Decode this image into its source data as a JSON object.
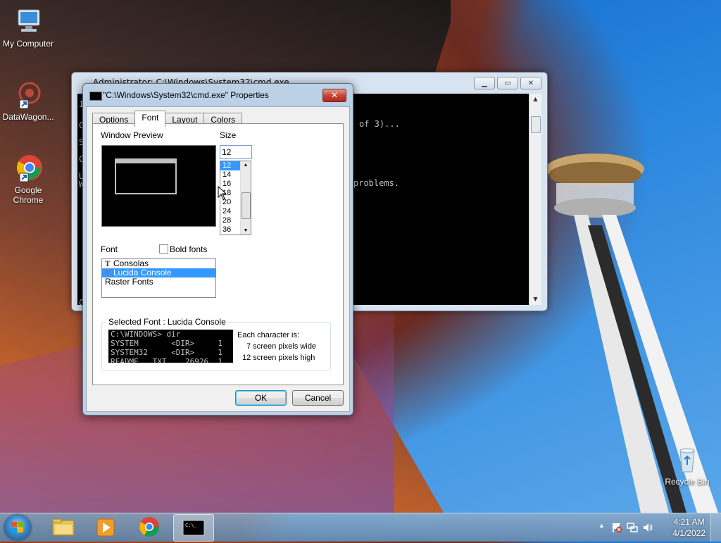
{
  "desktop": {
    "icons": [
      {
        "label": "My Computer",
        "icon": "computer-icon"
      },
      {
        "label": "DataWagon...",
        "icon": "datawagon-icon"
      },
      {
        "label": "Google Chrome",
        "icon": "chrome-icon"
      },
      {
        "label": "Recycle Bin",
        "icon": "recycle-bin-icon"
      }
    ]
  },
  "console": {
    "title": "Administrator: C:\\Windows\\System32\\cmd.exe",
    "lines": [
      "of 3)...",
      "problems."
    ],
    "left_chars": [
      "I",
      "C",
      "S",
      "C",
      "U",
      "W",
      "C"
    ]
  },
  "dialog": {
    "title": "\"C:\\Windows\\System32\\cmd.exe\" Properties",
    "close_label": "✕",
    "tabs": [
      "Options",
      "Font",
      "Layout",
      "Colors"
    ],
    "active_tab": "Font",
    "window_preview_label": "Window Preview",
    "size_label": "Size",
    "size_value": "12",
    "size_options": [
      "12",
      "14",
      "16",
      "18",
      "20",
      "24",
      "28",
      "36"
    ],
    "size_selected": "12",
    "font_label": "Font",
    "bold_fonts_label": "Bold fonts",
    "bold_fonts_checked": false,
    "fonts": [
      "Consolas",
      "Lucida Console",
      "Raster Fonts"
    ],
    "font_selected": "Lucida Console",
    "selected_font_legend": "Selected Font : Lucida Console",
    "sample_text": "C:\\WINDOWS> dir\nSYSTEM       <DIR>     1\nSYSTEM32     <DIR>     1\nREADME   TXT    26926  1",
    "char_info_title": "Each character is:",
    "char_width": "7 screen pixels wide",
    "char_height": "12 screen pixels high",
    "ok_label": "OK",
    "cancel_label": "Cancel"
  },
  "taskbar": {
    "items": [
      "start-button",
      "explorer",
      "media-player",
      "chrome",
      "cmd"
    ],
    "time": "4:21 AM",
    "date": "4/1/2022"
  }
}
